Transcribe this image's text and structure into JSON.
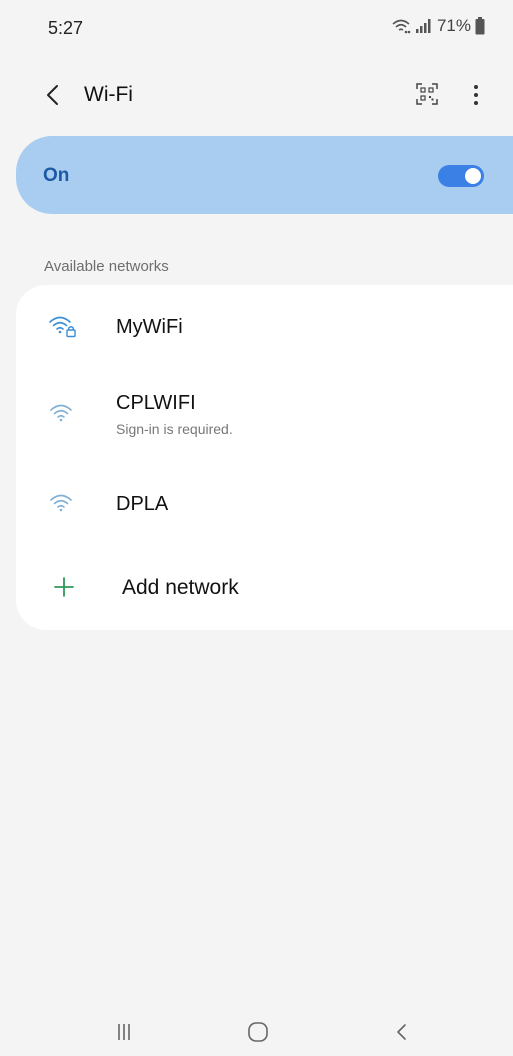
{
  "status_bar": {
    "time": "5:27",
    "battery_percent": "71%",
    "icons": [
      "wifi-icon",
      "signal-icon",
      "battery-icon"
    ]
  },
  "header": {
    "title": "Wi-Fi",
    "back_icon": "chevron-left-icon",
    "qr_icon": "qr-code-scan-icon",
    "more_icon": "more-vertical-icon"
  },
  "wifi_toggle": {
    "label": "On",
    "state": true
  },
  "section": {
    "label": "Available networks"
  },
  "networks": [
    {
      "name": "MyWiFi",
      "subtitle": "",
      "secured": true,
      "connected": true
    },
    {
      "name": "CPLWIFI",
      "subtitle": "Sign-in is required.",
      "secured": false,
      "connected": false
    },
    {
      "name": "DPLA",
      "subtitle": "",
      "secured": false,
      "connected": false
    }
  ],
  "add_network": {
    "label": "Add network",
    "icon": "plus-icon"
  },
  "nav_bar": {
    "icons": [
      "recents-icon",
      "home-icon",
      "back-icon"
    ]
  },
  "colors": {
    "background": "#f4f4f4",
    "toggle_card": "#a9cdf1",
    "toggle_text": "#1c5aa6",
    "switch_on": "#3b80e4",
    "wifi_connected": "#3b8fd6",
    "wifi_idle": "#7fb0d6",
    "add_icon": "#2e9a5a"
  }
}
